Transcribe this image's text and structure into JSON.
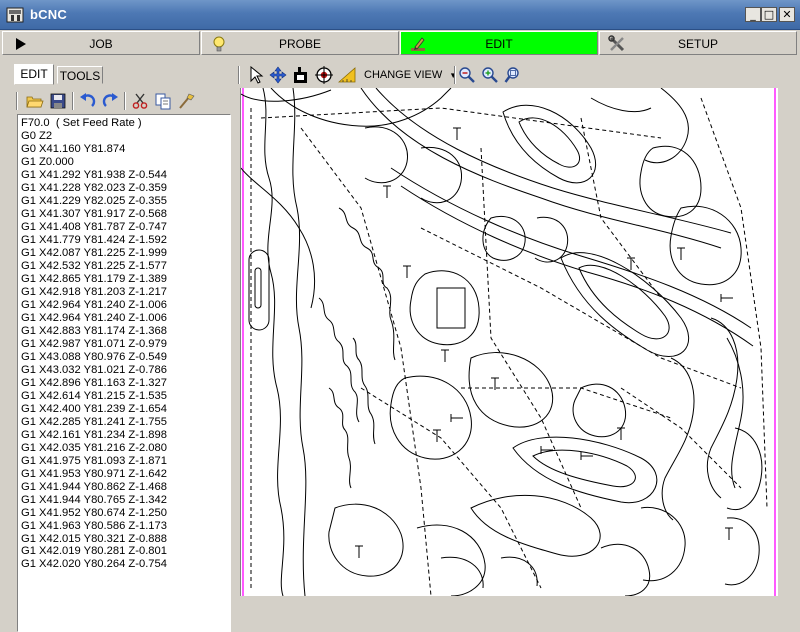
{
  "window": {
    "title": "bCNC",
    "controls": [
      "minimize-icon",
      "maximize-icon",
      "close-icon"
    ]
  },
  "main_tabs": [
    {
      "label": "JOB",
      "icon": "play-icon",
      "active": false
    },
    {
      "label": "PROBE",
      "icon": "lightbulb-icon",
      "active": false
    },
    {
      "label": "EDIT",
      "icon": "edit-pen-icon",
      "active": true
    },
    {
      "label": "SETUP",
      "icon": "tools-icon",
      "active": false
    }
  ],
  "colors": {
    "active_tab": "#00ff00",
    "canvas_border": "#ff00ff",
    "toolpath": "#000000",
    "titlebar": "#4d78b4"
  },
  "left_panel": {
    "tabs": [
      {
        "label": "EDIT",
        "active": true
      },
      {
        "label": "TOOLS",
        "active": false
      }
    ],
    "toolbar": [
      "open-folder-icon",
      "save-icon",
      "undo-icon",
      "redo-icon",
      "cut-icon",
      "copy-icon",
      "paste-icon"
    ],
    "gcode_lines": [
      "F70.0  ( Set Feed Rate )",
      "G0 Z2",
      "G0 X41.160 Y81.874",
      "G1 Z0.000",
      "G1 X41.292 Y81.938 Z-0.544",
      "G1 X41.228 Y82.023 Z-0.359",
      "G1 X41.229 Y82.025 Z-0.355",
      "G1 X41.307 Y81.917 Z-0.568",
      "G1 X41.408 Y81.787 Z-0.747",
      "G1 X41.779 Y81.424 Z-1.592",
      "G1 X42.087 Y81.225 Z-1.999",
      "G1 X42.532 Y81.225 Z-1.577",
      "G1 X42.865 Y81.179 Z-1.389",
      "G1 X42.918 Y81.203 Z-1.217",
      "G1 X42.964 Y81.240 Z-1.006",
      "G1 X42.964 Y81.240 Z-1.006",
      "G1 X42.883 Y81.174 Z-1.368",
      "G1 X42.987 Y81.071 Z-0.979",
      "G1 X43.088 Y80.976 Z-0.549",
      "G1 X43.032 Y81.021 Z-0.786",
      "G1 X42.896 Y81.163 Z-1.327",
      "G1 X42.614 Y81.215 Z-1.535",
      "G1 X42.400 Y81.239 Z-1.654",
      "G1 X42.285 Y81.241 Z-1.755",
      "G1 X42.161 Y81.234 Z-1.898",
      "G1 X42.035 Y81.216 Z-2.080",
      "G1 X41.975 Y81.093 Z-1.871",
      "G1 X41.953 Y80.971 Z-1.642",
      "G1 X41.944 Y80.862 Z-1.468",
      "G1 X41.944 Y80.765 Z-1.342",
      "G1 X41.952 Y80.674 Z-1.250",
      "G1 X41.963 Y80.586 Z-1.173",
      "G1 X42.015 Y80.321 Z-0.888",
      "G1 X42.019 Y80.281 Z-0.801",
      "G1 X42.020 Y80.264 Z-0.754"
    ]
  },
  "canvas_toolbar": {
    "tools": [
      "select-arrow-icon",
      "pan-move-icon",
      "origin-icon",
      "target-icon",
      "ruler-icon"
    ],
    "change_view_label": "CHANGE VIEW",
    "dropdown_icon": "triangle-down-icon",
    "zoom_tools": [
      "zoom-out-icon",
      "zoom-in-icon",
      "zoom-fit-icon"
    ]
  }
}
